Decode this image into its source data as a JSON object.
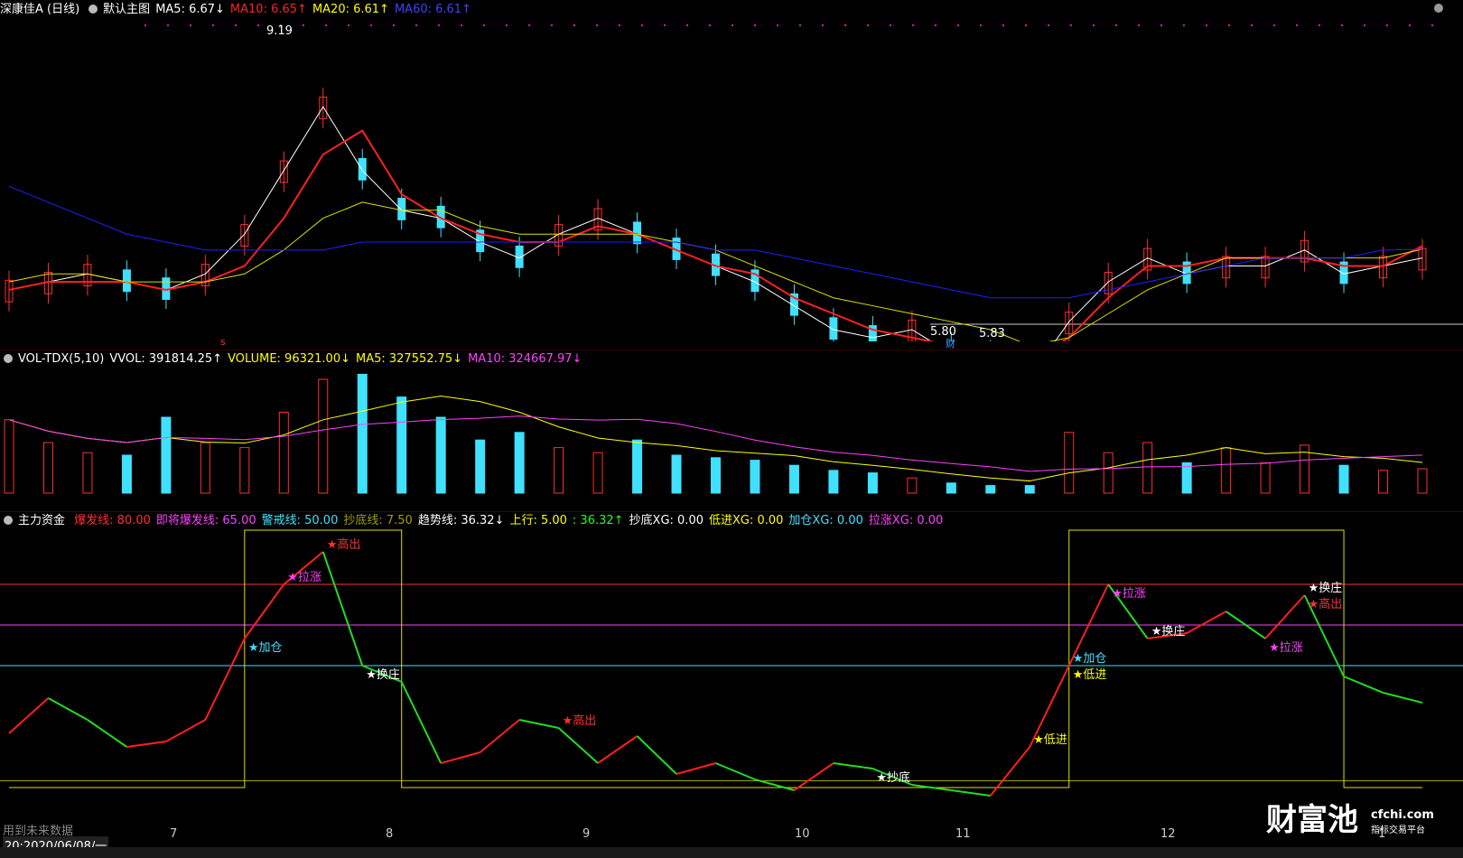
{
  "main": {
    "stock_name": "深康佳A (日线)",
    "template": "默认主图",
    "ma5": "MA5: 6.67↓",
    "ma10": "MA10: 6.65↑",
    "ma20": "MA20: 6.61↑",
    "ma60": "MA60: 6.61↑",
    "high_label": "9.19",
    "low_label": "5.80",
    "low_marker": "5.83",
    "cai_marker": "财",
    "s_marker": "s",
    "colors": {
      "ma5": "#ffffff",
      "ma10": "#ff2020",
      "ma20": "#ffff00",
      "ma60": "#2020ff",
      "up": "#ff3030",
      "down": "#40e0ff"
    }
  },
  "volume": {
    "title": "VOL-TDX(5,10)",
    "vvol": "VVOL: 391814.25↑",
    "volume": "VOLUME: 96321.00↓",
    "ma5": "MA5: 327552.75↓",
    "ma10": "MA10: 324667.97↓"
  },
  "indicator": {
    "title": "主力资金",
    "fields": [
      {
        "text": "爆发线: 80.00",
        "color": "#ff3030"
      },
      {
        "text": "即将爆发线: 65.00",
        "color": "#ff40ff"
      },
      {
        "text": "警戒线: 50.00",
        "color": "#40e0ff"
      },
      {
        "text": "抄底线: 7.50",
        "color": "#a0a000"
      },
      {
        "text": "趋势线: 36.32↓",
        "color": "#ffffff"
      },
      {
        "text": "上行: 5.00",
        "color": "#ffff00"
      },
      {
        "text": ": 36.32↑",
        "color": "#20ff20"
      },
      {
        "text": "抄底XG: 0.00",
        "color": "#ffffff"
      },
      {
        "text": "低进XG: 0.00",
        "color": "#ffff00"
      },
      {
        "text": "加仓XG: 0.00",
        "color": "#40e0ff"
      },
      {
        "text": "拉涨XG: 0.00",
        "color": "#ff40ff"
      }
    ],
    "signals": [
      {
        "text": "★高出",
        "color": "#ff3030"
      },
      {
        "text": "★换庄",
        "color": "#ffffff"
      },
      {
        "text": "★拉涨",
        "color": "#ff40ff"
      },
      {
        "text": "★加仓",
        "color": "#40e0ff"
      },
      {
        "text": "★高出",
        "color": "#ff3030"
      },
      {
        "text": "★抄底",
        "color": "#ffffff"
      },
      {
        "text": "★低进",
        "color": "#ffff00"
      },
      {
        "text": "★低进",
        "color": "#ffff00"
      },
      {
        "text": "★加仓",
        "color": "#40e0ff"
      },
      {
        "text": "★拉涨",
        "color": "#ff40ff"
      },
      {
        "text": "★换庄",
        "color": "#ffffff"
      },
      {
        "text": "★拉涨",
        "color": "#ff40ff"
      },
      {
        "text": "★换庄",
        "color": "#ffffff"
      },
      {
        "text": "★高出",
        "color": "#ff3030"
      }
    ],
    "future_data": "用到未来数据",
    "cursor_date": "20:2020/06/08/一"
  },
  "chart_data": [
    {
      "type": "line",
      "title": "深康佳A (日线)",
      "xlabel": "",
      "ylabel": "",
      "x_ticks": [
        "7",
        "8",
        "9",
        "10",
        "11",
        "12",
        "1"
      ],
      "series": [
        {
          "name": "MA5",
          "values": [
            6.1,
            6.2,
            6.3,
            6.2,
            6.1,
            6.3,
            6.8,
            7.6,
            8.4,
            7.6,
            7.1,
            7.0,
            6.7,
            6.5,
            6.8,
            7.0,
            6.8,
            6.6,
            6.4,
            6.2,
            5.9,
            5.6,
            5.5,
            5.6,
            5.3,
            5.2,
            5.0,
            5.7,
            6.2,
            6.5,
            6.3,
            6.4,
            6.4,
            6.6,
            6.3,
            6.4,
            6.5
          ]
        },
        {
          "name": "MA10",
          "values": [
            6.1,
            6.2,
            6.2,
            6.2,
            6.1,
            6.2,
            6.4,
            7.0,
            7.8,
            8.1,
            7.3,
            7.0,
            6.8,
            6.7,
            6.7,
            6.9,
            6.8,
            6.6,
            6.4,
            6.3,
            6.0,
            5.8,
            5.6,
            5.5,
            5.4,
            5.3,
            5.2,
            5.5,
            6.0,
            6.4,
            6.4,
            6.5,
            6.5,
            6.5,
            6.4,
            6.4,
            6.65
          ]
        },
        {
          "name": "MA20",
          "values": [
            6.2,
            6.3,
            6.3,
            6.2,
            6.2,
            6.2,
            6.3,
            6.6,
            7.0,
            7.2,
            7.1,
            7.1,
            6.9,
            6.8,
            6.8,
            6.8,
            6.8,
            6.7,
            6.6,
            6.4,
            6.2,
            6.0,
            5.9,
            5.8,
            5.7,
            5.6,
            5.4,
            5.5,
            5.8,
            6.1,
            6.3,
            6.5,
            6.5,
            6.5,
            6.5,
            6.5,
            6.61
          ]
        },
        {
          "name": "MA60",
          "values": [
            7.4,
            7.2,
            7.0,
            6.8,
            6.7,
            6.6,
            6.6,
            6.6,
            6.6,
            6.7,
            6.7,
            6.7,
            6.7,
            6.7,
            6.7,
            6.7,
            6.7,
            6.7,
            6.6,
            6.6,
            6.5,
            6.4,
            6.3,
            6.2,
            6.1,
            6.0,
            6.0,
            6.0,
            6.1,
            6.2,
            6.3,
            6.4,
            6.5,
            6.5,
            6.5,
            6.6,
            6.61
          ]
        }
      ],
      "annotations": [
        "9.19",
        "5.80",
        "5.83"
      ]
    },
    {
      "type": "bar",
      "title": "VOL-TDX(5,10)",
      "values": [
        290,
        200,
        160,
        150,
        300,
        200,
        180,
        320,
        450,
        470,
        380,
        300,
        210,
        240,
        180,
        160,
        210,
        150,
        140,
        130,
        110,
        90,
        80,
        60,
        40,
        30,
        30,
        240,
        160,
        200,
        120,
        180,
        120,
        190,
        110,
        90,
        96.3
      ],
      "units": "thousand"
    },
    {
      "type": "line",
      "title": "主力资金",
      "reference_lines": {
        "爆发线": 80,
        "即将爆发线": 65,
        "警戒线": 50,
        "抄底线": 7.5
      },
      "series": [
        {
          "name": "趋势线",
          "values": [
            25,
            38,
            30,
            20,
            22,
            30,
            60,
            80,
            92,
            50,
            44,
            14,
            18,
            30,
            27,
            14,
            24,
            10,
            14,
            8,
            4,
            14,
            12,
            6,
            4,
            2,
            20,
            50,
            80,
            60,
            62,
            70,
            60,
            76,
            46,
            40,
            36.32
          ]
        }
      ]
    }
  ]
}
